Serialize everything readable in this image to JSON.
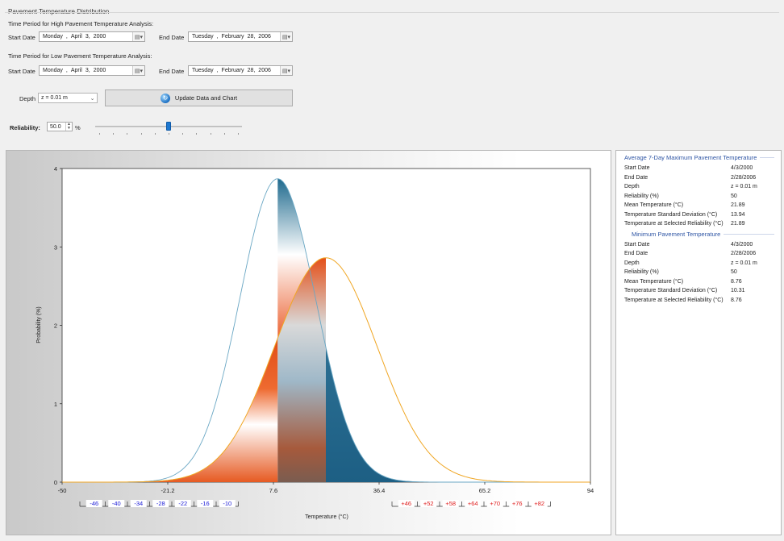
{
  "group_title": "Pavement Temperature Distribution",
  "high_period": {
    "label": "Time Period for High Pavement Temperature Analysis:",
    "start_label": "Start Date",
    "start": {
      "weekday": "Monday",
      "month": "April",
      "day": "3,",
      "year": "2000"
    },
    "end_label": "End Date",
    "end": {
      "weekday": "Tuesday",
      "month": "February",
      "day": "28,",
      "year": "2006"
    }
  },
  "low_period": {
    "label": "Time Period for Low Pavement Temperature Analysis:",
    "start_label": "Start Date",
    "start": {
      "weekday": "Monday",
      "month": "April",
      "day": "3,",
      "year": "2000"
    },
    "end_label": "End Date",
    "end": {
      "weekday": "Tuesday",
      "month": "February",
      "day": "28,",
      "year": "2006"
    }
  },
  "depth": {
    "label": "Depth",
    "value": "z = 0.01 m"
  },
  "update_button": "Update Data and Chart",
  "reliability": {
    "label": "Reliability:",
    "value": "50.0",
    "unit": "%",
    "slider_fraction": 0.5
  },
  "chart_data": {
    "type": "area",
    "xlabel": "Temperature (°C)",
    "ylabel": "Probability (%)",
    "xlim": [
      -50,
      94
    ],
    "ylim": [
      0,
      4
    ],
    "x_ticks": [
      "-50",
      "-21.2",
      "7.6",
      "36.4",
      "65.2",
      "94"
    ],
    "x_tick_values": [
      -50,
      -21.2,
      7.6,
      36.4,
      65.2,
      94
    ],
    "y_ticks": [
      "0",
      "1",
      "2",
      "3",
      "4"
    ],
    "series": [
      {
        "mean": 8.76,
        "sd": 10.31,
        "color": "#2b6f93"
      },
      {
        "mean": 21.89,
        "sd": 13.94,
        "color": "#f0a623"
      }
    ],
    "low_grades": [
      "-46",
      "-40",
      "-34",
      "-28",
      "-22",
      "-16",
      "-10"
    ],
    "high_grades": [
      "+46",
      "+52",
      "+58",
      "+64",
      "+70",
      "+76",
      "+82"
    ],
    "low_grade_color": "#2020d8",
    "high_grade_color": "#e02020"
  },
  "max_section": {
    "title": "Average 7-Day Maximum Pavement Temperature",
    "rows": [
      {
        "k": "Start Date",
        "v": "4/3/2000"
      },
      {
        "k": "End Date",
        "v": "2/28/2006"
      },
      {
        "k": "Depth",
        "v": "z = 0.01 m"
      },
      {
        "k": "Reliability (%)",
        "v": "50"
      },
      {
        "k": "Mean Temperature (°C)",
        "v": "21.89"
      },
      {
        "k": "Temperature Standard Deviation (°C)",
        "v": "13.94"
      },
      {
        "k": "Temperature at Selected Reliability (°C)",
        "v": "21.89"
      }
    ]
  },
  "min_section": {
    "title": "Minimum Pavement Temperature",
    "rows": [
      {
        "k": "Start Date",
        "v": "4/3/2000"
      },
      {
        "k": "End Date",
        "v": "2/28/2006"
      },
      {
        "k": "Depth",
        "v": "z = 0.01 m"
      },
      {
        "k": "Reliability (%)",
        "v": "50"
      },
      {
        "k": "Mean Temperature (°C)",
        "v": "8.76"
      },
      {
        "k": "Temperature Standard Deviation (°C)",
        "v": "10.31"
      },
      {
        "k": "Temperature at Selected Reliability (°C)",
        "v": "8.76"
      }
    ]
  }
}
